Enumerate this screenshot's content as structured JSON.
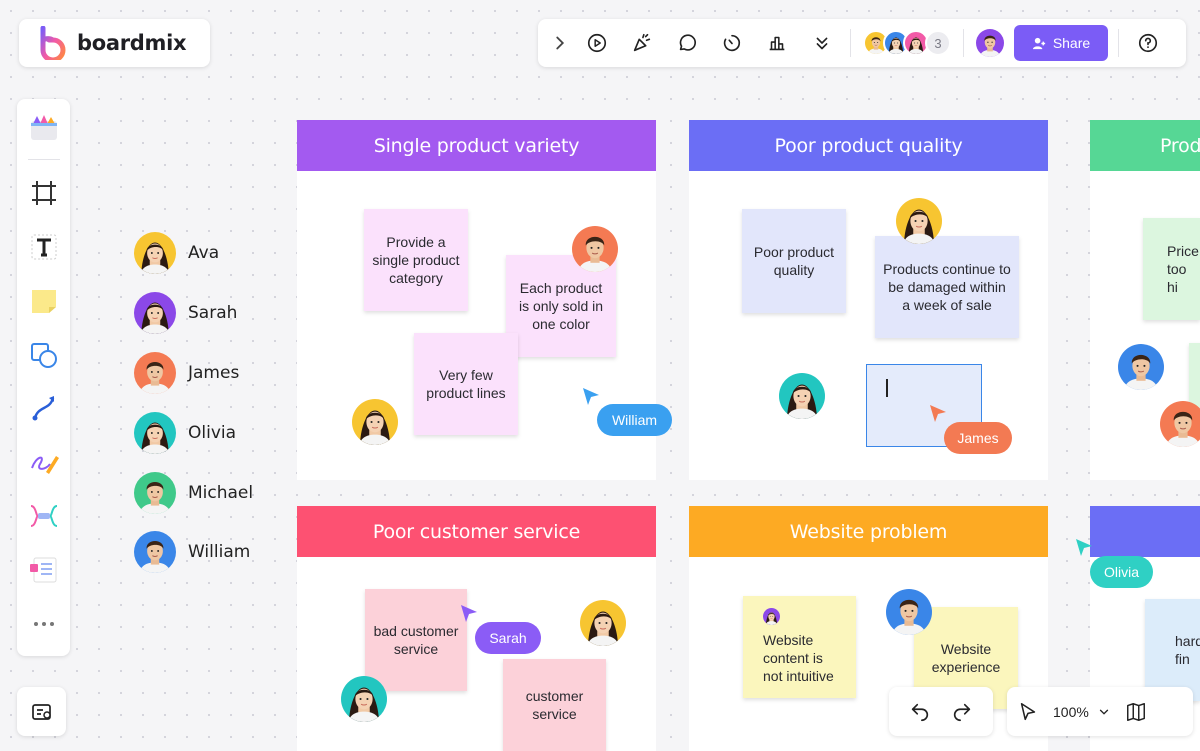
{
  "app": {
    "name": "boardmix"
  },
  "toolbar": {
    "collaborator_count": "3",
    "share_label": "Share"
  },
  "people": [
    {
      "name": "Ava",
      "color": "#f7c531"
    },
    {
      "name": "Sarah",
      "color": "#8b48e8"
    },
    {
      "name": "James",
      "color": "#f47a53"
    },
    {
      "name": "Olivia",
      "color": "#22c6c0"
    },
    {
      "name": "Michael",
      "color": "#3fc98a"
    },
    {
      "name": "William",
      "color": "#3a86e8"
    }
  ],
  "columns": [
    {
      "title": "Single product variety",
      "color": "#a35af0",
      "notes": [
        "Provide a single product category",
        "Each product is only sold in one color",
        "Very few product lines"
      ]
    },
    {
      "title": "Poor product quality",
      "color": "#6b6ef5",
      "notes": [
        "Poor product quality",
        "Products continue to be damaged within a week of sale"
      ]
    },
    {
      "title": "Prod",
      "color": "#56d795",
      "notes": [
        "Price too hi"
      ]
    },
    {
      "title": "Poor customer service",
      "color": "#fd5172",
      "notes": [
        "bad customer service",
        "customer service"
      ]
    },
    {
      "title": "Website problem",
      "color": "#fdaa23",
      "notes": [
        "Website content is not intuitive",
        "Website experience"
      ]
    },
    {
      "title": "",
      "color": "#6b6ef5",
      "notes": [
        "hard fin"
      ]
    }
  ],
  "cursors": [
    {
      "name": "William",
      "color": "#3aa0f0"
    },
    {
      "name": "James",
      "color": "#f37a53"
    },
    {
      "name": "Sarah",
      "color": "#8b5cf6"
    },
    {
      "name": "Olivia",
      "color": "#2fd0c4"
    }
  ],
  "zoom": {
    "level": "100%"
  }
}
